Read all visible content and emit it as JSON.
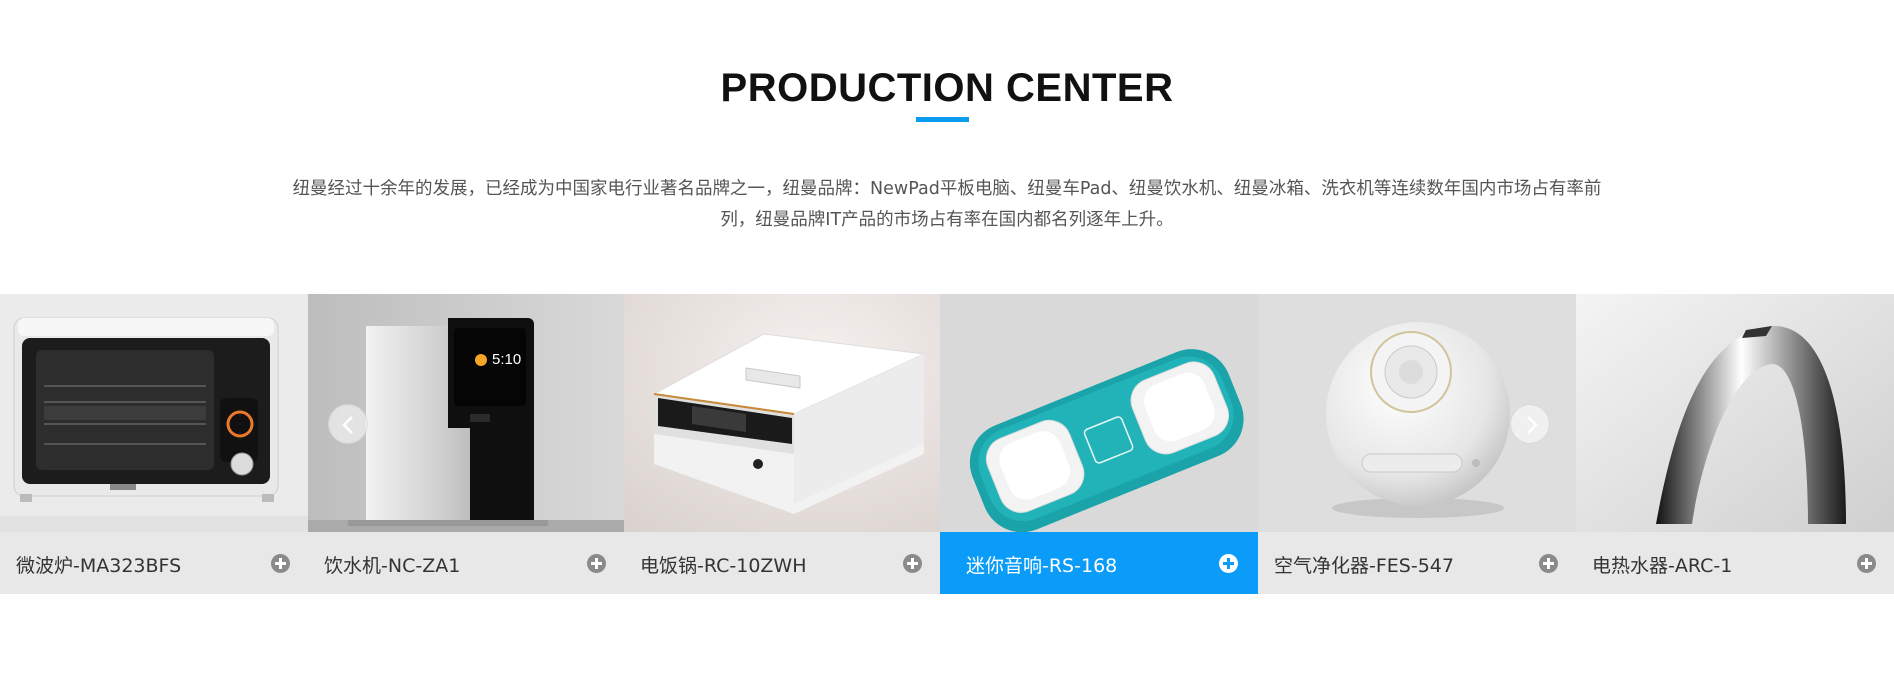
{
  "section": {
    "title": "PRODUCTION CENTER",
    "intro_line1": "纽曼经过十余年的发展，已经成为中国家电行业著名品牌之一，纽曼品牌：NewPad平板电脑、纽曼车Pad、纽曼饮水机、纽曼冰箱、洗衣机等连续数年国内市场占有率前",
    "intro_line2": "列，纽曼品牌IT产品的市场占有率在国内都名列逐年上升。"
  },
  "products": [
    {
      "name": "微波炉-MA323BFS",
      "icon": "plus-circle-icon"
    },
    {
      "name": "饮水机-NC-ZA1",
      "icon": "plus-circle-icon",
      "screen_time": "5:10"
    },
    {
      "name": "电饭锅-RC-10ZWH",
      "icon": "plus-circle-icon"
    },
    {
      "name": "迷你音响-RS-168",
      "icon": "plus-circle-icon",
      "active": true
    },
    {
      "name": "空气净化器-FES-547",
      "icon": "plus-circle-icon"
    },
    {
      "name": "电热水器-ARC-1",
      "icon": "plus-circle-icon"
    }
  ],
  "colors": {
    "accent": "#0a9cf8",
    "caption_bg": "#e8e8e8",
    "title": "#111111",
    "text": "#555555"
  },
  "nav": {
    "prev_icon": "chevron-left-icon",
    "next_icon": "chevron-right-icon"
  }
}
